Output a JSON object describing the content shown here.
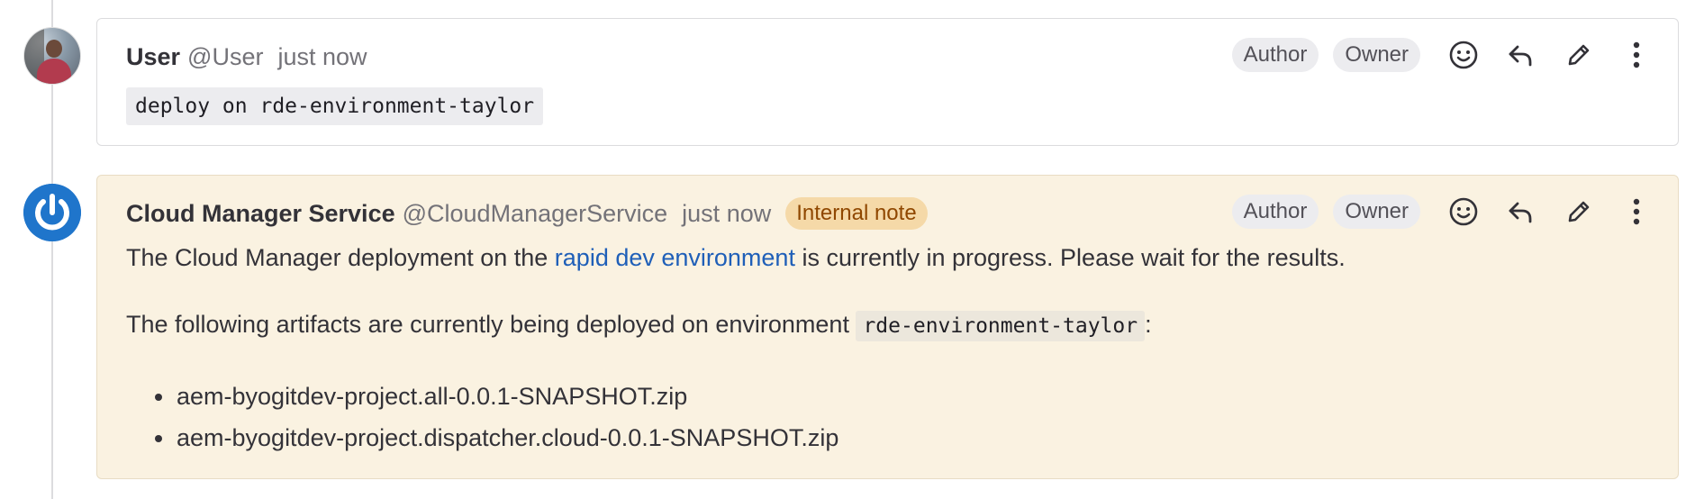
{
  "notes": [
    {
      "author_name": "User",
      "author_handle": "@User",
      "timestamp": "just now",
      "badges": [
        "Author",
        "Owner"
      ],
      "code": "deploy on rde-environment-taylor"
    },
    {
      "author_name": "Cloud Manager Service",
      "author_handle": "@CloudManagerService",
      "timestamp": "just now",
      "internal_label": "Internal note",
      "badges": [
        "Author",
        "Owner"
      ],
      "para1_before": "The Cloud Manager deployment on the ",
      "para1_link": "rapid dev environment",
      "para1_after": " is currently in progress. Please wait for the results.",
      "para2_before": "The following artifacts are currently being deployed on environment ",
      "para2_code": "rde-environment-taylor",
      "para2_after": ":",
      "artifacts": [
        "aem-byogitdev-project.all-0.0.1-SNAPSHOT.zip",
        "aem-byogitdev-project.dispatcher.cloud-0.0.1-SNAPSHOT.zip"
      ]
    }
  ],
  "icons": [
    "smiley-icon",
    "reply-icon",
    "pencil-icon",
    "more-vertical-icon"
  ],
  "colors": {
    "internal_bg": "#faf2e1",
    "internal_badge_bg": "#f5d9a8",
    "internal_badge_text": "#8f4700",
    "link": "#1f5fb8",
    "service_avatar": "#1f75cb"
  }
}
